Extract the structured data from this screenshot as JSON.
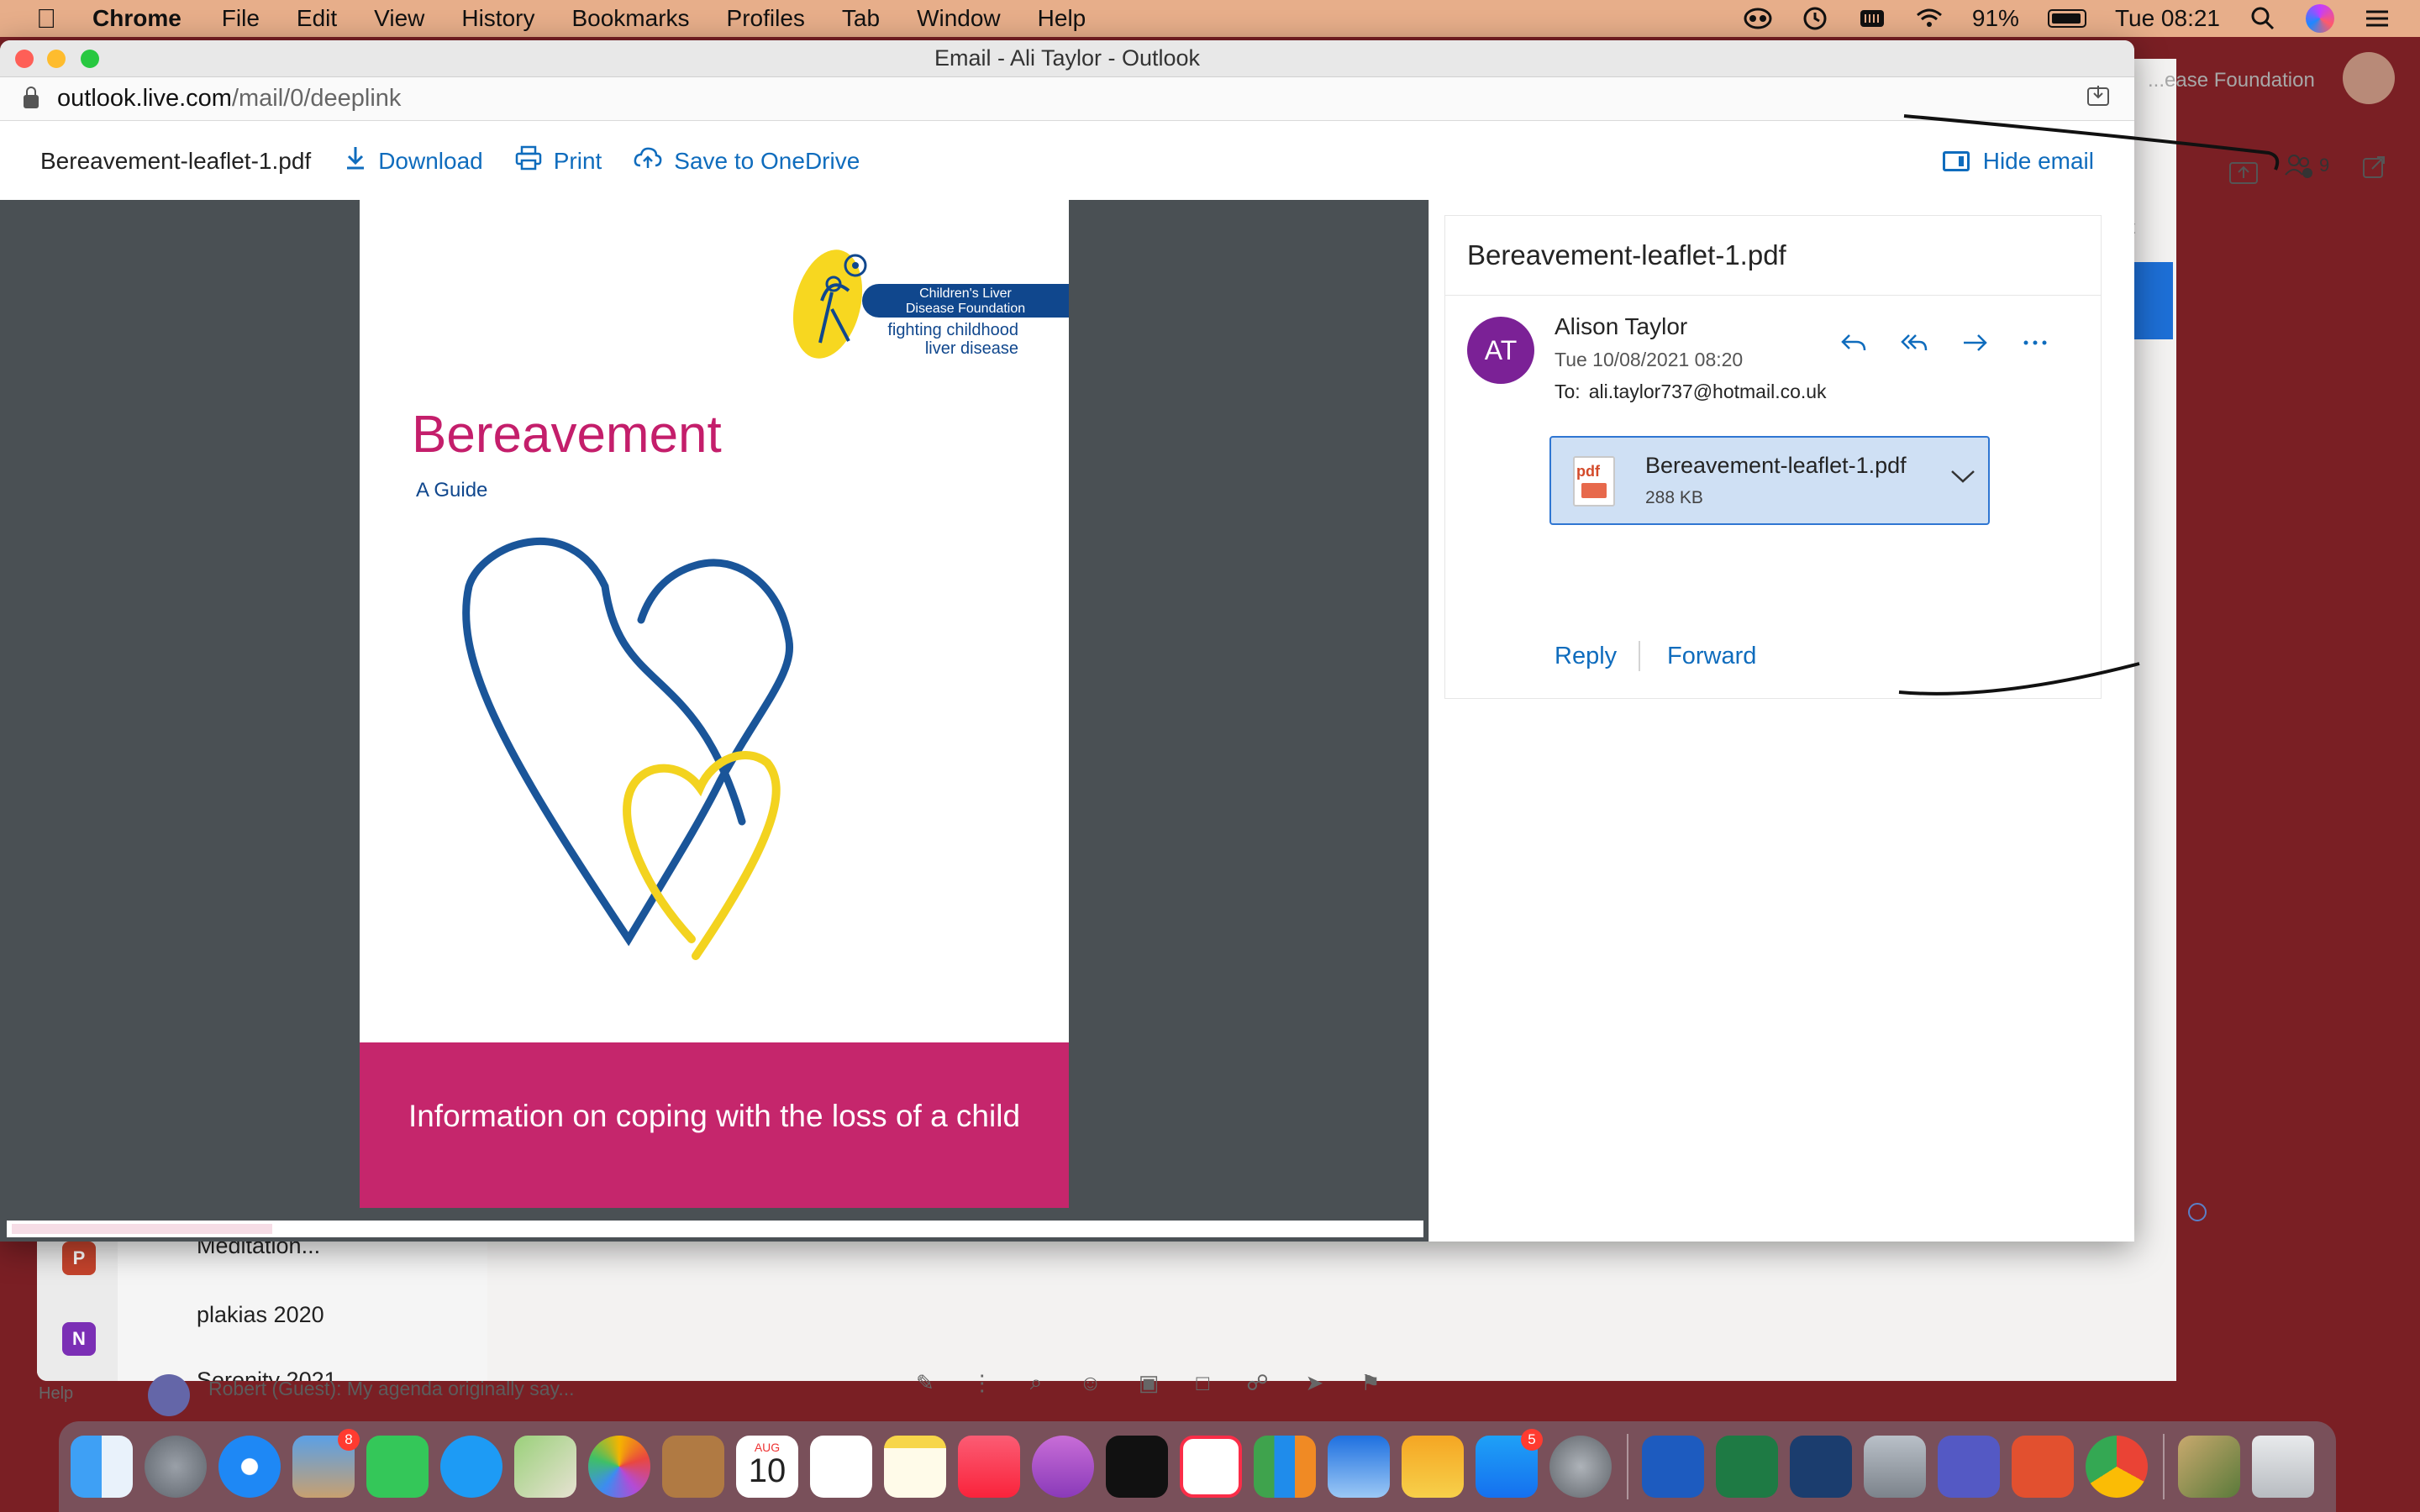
{
  "menubar": {
    "app": "Chrome",
    "items": [
      "File",
      "Edit",
      "View",
      "History",
      "Bookmarks",
      "Profiles",
      "Tab",
      "Window",
      "Help"
    ],
    "battery": "91%",
    "clock": "Tue 08:21"
  },
  "background_window": {
    "org_name": "...ease Foundation",
    "people_count": "9",
    "list_items": [
      "Meditation...",
      "plakias 2020",
      "Serenity 2021"
    ],
    "chat_preview": "Robert (Guest): My agenda originally say...",
    "help": "Help",
    "partial_label": "st"
  },
  "window": {
    "title": "Email - Ali Taylor - Outlook",
    "url_host": "outlook.live.com",
    "url_path": "/mail/0/deeplink"
  },
  "toolbar": {
    "filename": "Bereavement-leaflet-1.pdf",
    "download": "Download",
    "print": "Print",
    "save": "Save to OneDrive",
    "hide_email": "Hide email"
  },
  "pdf": {
    "org_line1": "Children's Liver",
    "org_line2": "Disease Foundation",
    "tagline1": "fighting childhood",
    "tagline2": "liver disease",
    "title": "Bereavement",
    "subtitle": "A Guide",
    "band_text": "Information on coping with the loss of a child"
  },
  "email": {
    "subject": "Bereavement-leaflet-1.pdf",
    "avatar_initials": "AT",
    "sender": "Alison Taylor",
    "date": "Tue 10/08/2021 08:20",
    "to_label": "To:",
    "to_address": "ali.taylor737@hotmail.co.uk",
    "attachment_name": "Bereavement-leaflet-1.pdf",
    "attachment_size": "288 KB",
    "attachment_icon_label": "pdf",
    "reply": "Reply",
    "forward": "Forward"
  },
  "dock": {
    "calendar_month": "AUG",
    "calendar_day": "10",
    "mail_badge": "8",
    "appstore_badge": "5"
  },
  "colors": {
    "accent": "#0f6cbd",
    "leaflet_pink": "#c5266c",
    "leaflet_blue": "#10478d",
    "avatar": "#7b2196"
  }
}
